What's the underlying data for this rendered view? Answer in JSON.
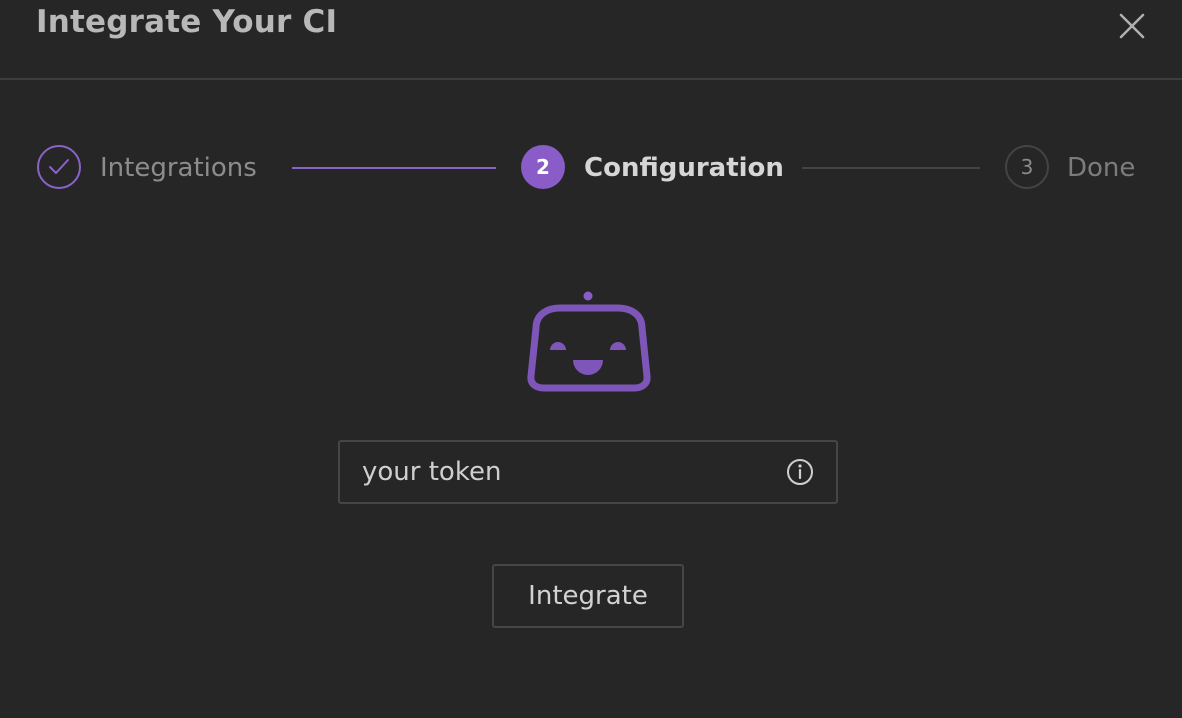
{
  "dialog": {
    "title": "Integrate Your CI",
    "close_icon": "close-icon"
  },
  "stepper": {
    "steps": [
      {
        "label": "Integrations",
        "number": "",
        "state": "completed",
        "icon": "checkmark-icon"
      },
      {
        "label": "Configuration",
        "number": "2",
        "state": "active"
      },
      {
        "label": "Done",
        "number": "3",
        "state": "pending"
      }
    ]
  },
  "content": {
    "illustration": "robot-icon",
    "token_input": {
      "placeholder": "your token",
      "value": "",
      "info_icon": "info-icon"
    },
    "integrate_button": "Integrate"
  },
  "colors": {
    "accent": "#8a5cc8",
    "background": "#262626",
    "border": "#464646"
  }
}
